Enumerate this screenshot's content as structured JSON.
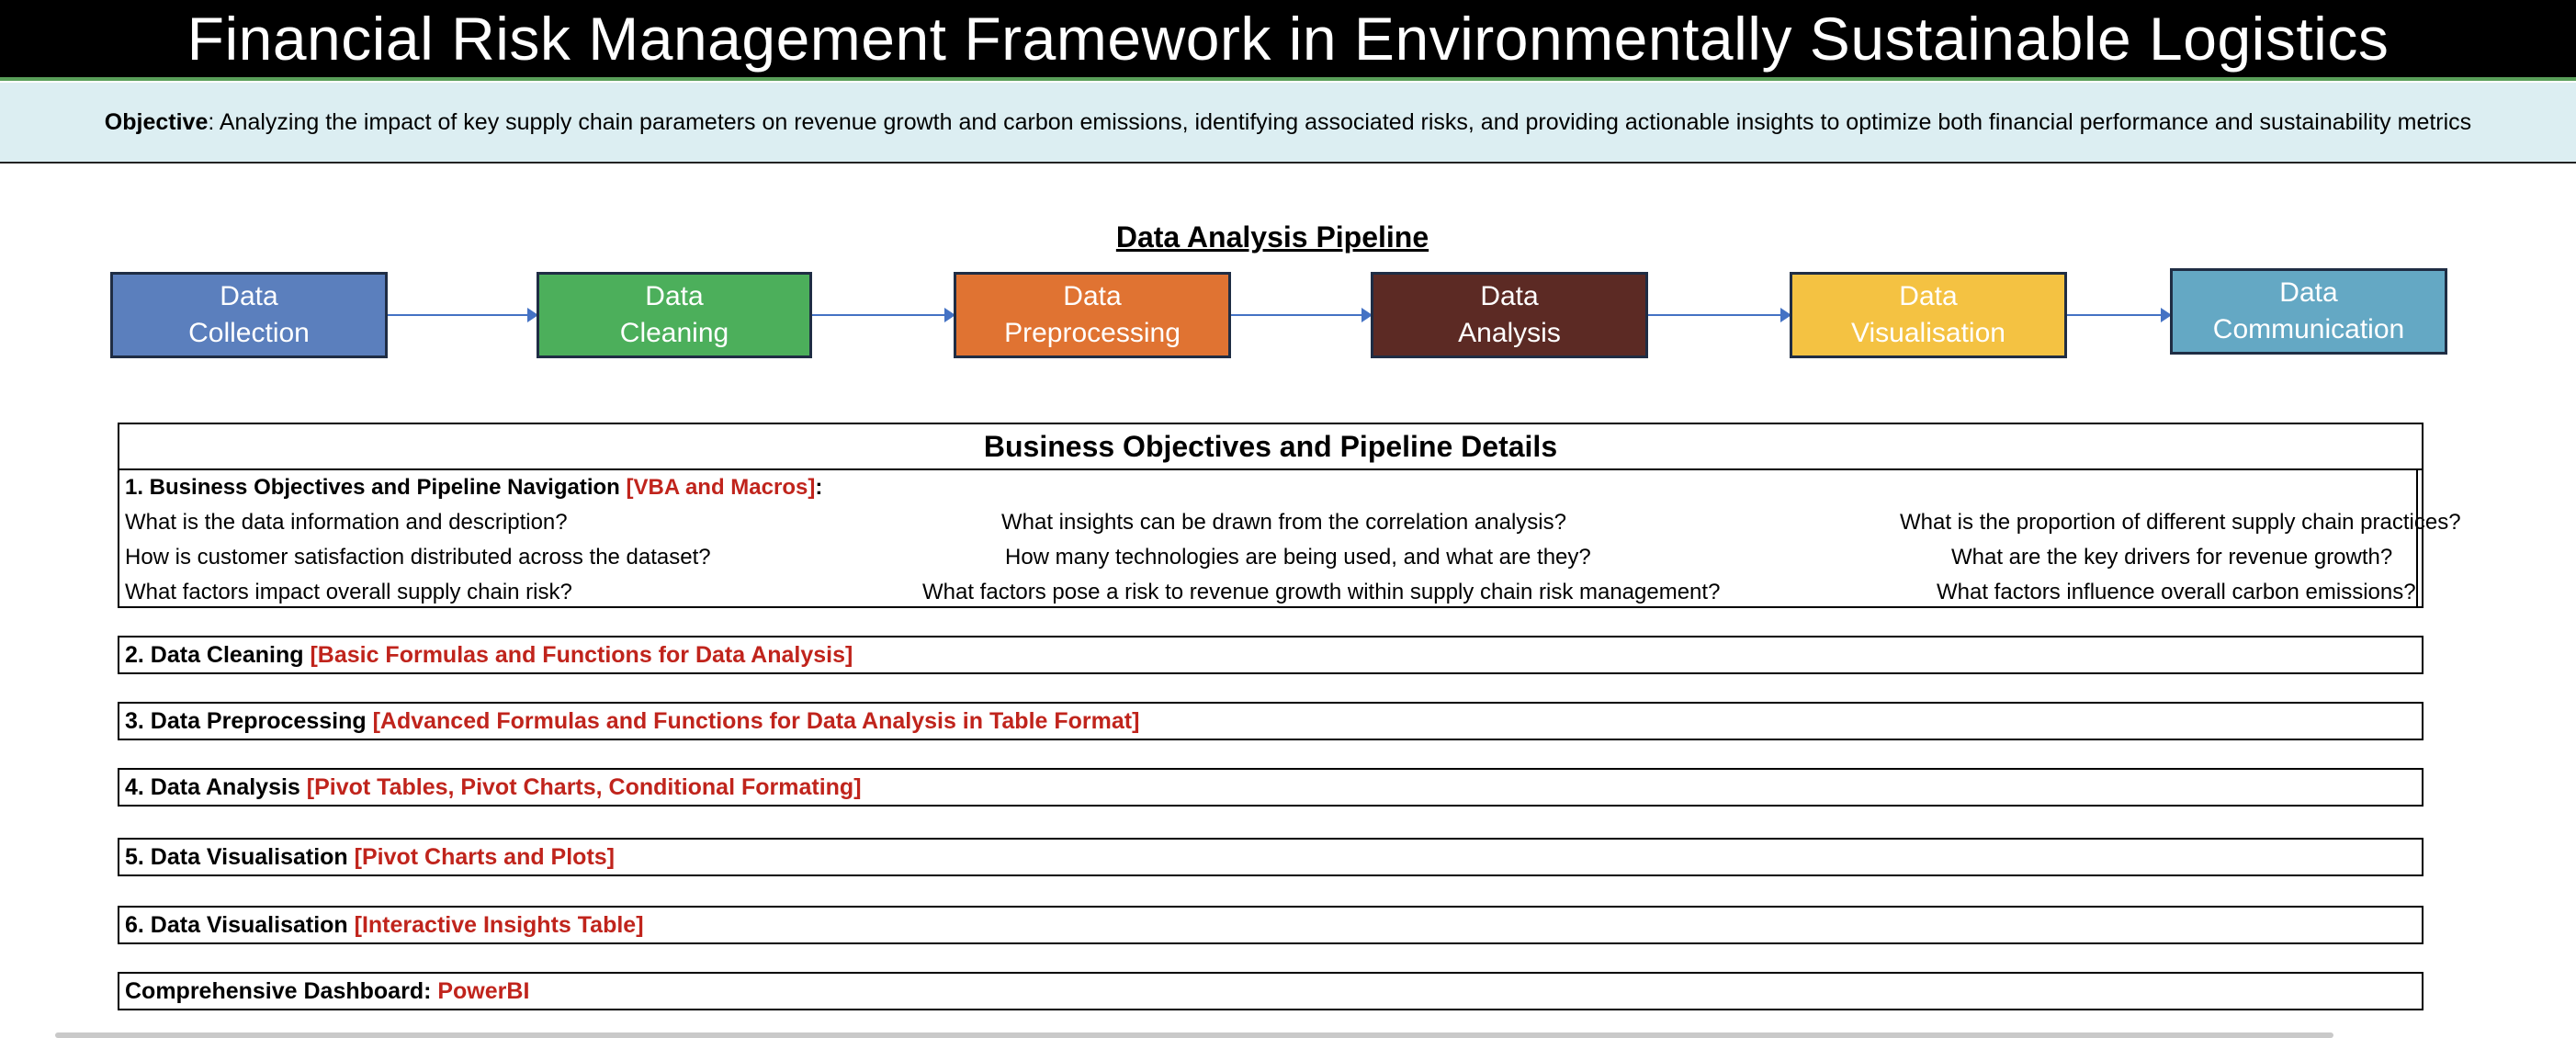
{
  "title": "Financial Risk Management Framework in Environmentally Sustainable Logistics",
  "objective": {
    "label": "Objective",
    "text": ": Analyzing the impact of key supply chain parameters on revenue growth and carbon emissions, identifying associated risks, and providing actionable insights to optimize both financial performance and sustainability metrics"
  },
  "pipeline": {
    "title": "Data Analysis Pipeline",
    "steps": [
      {
        "line1": "Data",
        "line2": "Collection",
        "color": "#5b7fbd"
      },
      {
        "line1": "Data",
        "line2": "Cleaning",
        "color": "#4caf5b"
      },
      {
        "line1": "Data",
        "line2": "Preprocessing",
        "color": "#e07332"
      },
      {
        "line1": "Data",
        "line2": "Analysis",
        "color": "#5c2a24"
      },
      {
        "line1": "Data",
        "line2": "Visualisation",
        "color": "#f4c242"
      },
      {
        "line1": "Data",
        "line2": "Communication",
        "color": "#64a8c4"
      }
    ]
  },
  "details": {
    "title": "Business Objectives and Pipeline Details",
    "section1": {
      "label": "1. Business Objectives and Pipeline Navigation ",
      "tag": "[VBA and Macros]",
      "suffix": ":",
      "questions": [
        [
          "What is the data information and description?",
          "What insights can be drawn from the correlation analysis?",
          "What is the proportion of different supply chain practices?"
        ],
        [
          "How is customer satisfaction distributed across the dataset?",
          "How many technologies are being used, and what are they?",
          "What are the key drivers for revenue growth?"
        ],
        [
          "What factors impact overall supply chain risk?",
          "What factors pose a risk to revenue growth within supply chain risk management?",
          "What factors influence overall carbon emissions?"
        ]
      ]
    },
    "sections": [
      {
        "label": "2. Data Cleaning ",
        "tag": "[Basic Formulas and Functions for Data Analysis]"
      },
      {
        "label": "3. Data Preprocessing ",
        "tag": "[Advanced Formulas and Functions for Data Analysis in Table Format]"
      },
      {
        "label": "4. Data Analysis ",
        "tag": "[Pivot Tables, Pivot Charts, Conditional Formating]"
      },
      {
        "label": "5. Data Visualisation ",
        "tag": "[Pivot Charts and Plots]"
      },
      {
        "label": "6. Data Visualisation ",
        "tag": "[Interactive Insights Table]"
      },
      {
        "label": "Comprehensive Dashboard: ",
        "tag": "PowerBI"
      }
    ]
  },
  "colors": {
    "accent_red": "#c0241c",
    "objective_bg": "#dceef2",
    "arrow": "#4472c4"
  }
}
